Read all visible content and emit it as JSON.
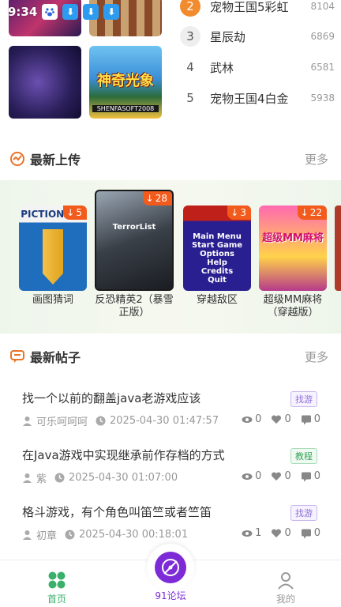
{
  "status_bar": {
    "time": "9:34"
  },
  "rank_list": [
    {
      "rank": "2",
      "name": "宠物王国5彩虹",
      "count": "8104"
    },
    {
      "rank": "3",
      "name": "星辰劫",
      "count": "6869"
    },
    {
      "rank": "4",
      "name": "武林",
      "count": "6581"
    },
    {
      "rank": "5",
      "name": "宠物王国4白金",
      "count": "5938"
    }
  ],
  "thumb_text": {
    "shen_title": "神奇光象",
    "shen_sub": "SHENFASOFT2008"
  },
  "latest_uploads": {
    "title": "最新上传",
    "more": "更多",
    "games": [
      {
        "title": "画图猜词",
        "downloads": "5",
        "cover_text": "PICTIONARY"
      },
      {
        "title": "反恐精英2（暴雪正版）",
        "downloads": "28",
        "cover_text": "TerrorList"
      },
      {
        "title": "穿越敌区",
        "downloads": "3",
        "cover_text": "Main Menu\nStart Game\nOptions\nHelp\nCredits\nQuit"
      },
      {
        "title": "超级MM麻将（穿越版）",
        "downloads": "22",
        "cover_text": "超级MM麻将"
      }
    ]
  },
  "latest_posts": {
    "title": "最新帖子",
    "more": "更多",
    "posts": [
      {
        "title": "找一个以前的翻盖java老游戏应该",
        "tag": "找游",
        "tag_color": "purple",
        "author": "可乐呵呵呵",
        "time": "2025-04-30 01:47:57",
        "views": "0",
        "likes": "0",
        "comments": "0"
      },
      {
        "title": "在Java游戏中实现继承前作存档的方式",
        "tag": "教程",
        "tag_color": "green",
        "author": "紫",
        "time": "2025-04-30 01:07:00",
        "views": "0",
        "likes": "0",
        "comments": "0"
      },
      {
        "title": "格斗游戏，有个角色叫笛竺或者竺笛",
        "tag": "找游",
        "tag_color": "purple",
        "author": "初章",
        "time": "2025-04-30 00:18:01",
        "views": "1",
        "likes": "0",
        "comments": "0"
      }
    ]
  },
  "bottom_nav": {
    "home": "首页",
    "forum": "91论坛",
    "me": "我的"
  },
  "colors": {
    "accent_green": "#3ab06a",
    "accent_purple": "#7d2bd6",
    "badge_orange": "#f25b1c",
    "rank_orange": "#f28a2e"
  }
}
